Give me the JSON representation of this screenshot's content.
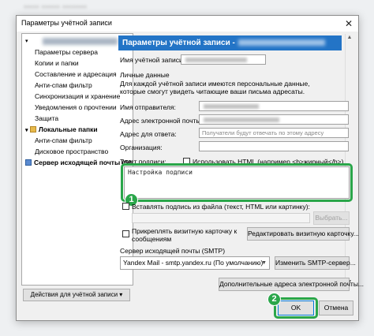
{
  "window": {
    "title": "Параметры учётной записи",
    "close_glyph": "✕"
  },
  "tree": {
    "server_settings": "Параметры сервера",
    "copies_folders": "Копии и папки",
    "composition": "Составление и адресация",
    "spam": "Анти-спам фильтр",
    "sync": "Синхронизация и хранение",
    "receipts": "Уведомления о прочтении",
    "security": "Защита",
    "local_folders": "Локальные папки",
    "local_spam": "Анти-спам фильтр",
    "disk_space": "Дисковое пространство",
    "outgoing_server": "Сервер исходящей почты (SMTP)"
  },
  "account_actions": "Действия для учётной записи ▾",
  "header": "Параметры учётной записи -",
  "account_name_label": "Имя учётной записи:",
  "personal_data_label": "Личные данные",
  "personal_desc": "Для каждой учётной записи имеются персональные данные, которые смогут увидеть читающие ваши письма адресаты.",
  "fields": {
    "sender_name": "Имя отправителя:",
    "email": "Адрес электронной почты:",
    "reply_to": "Адрес для ответа:",
    "reply_to_placeholder": "Получатели будут отвечать по этому адресу",
    "organization": "Организация:"
  },
  "signature": {
    "label": "Текст подписи:",
    "use_html": "Использовать HTML (например <b>жирный</b>)",
    "text": "Настройка подписи",
    "from_file": "Вставлять подпись из файла (текст, HTML или картинку):",
    "choose_btn": "Выбрать..."
  },
  "vcard": {
    "attach": "Прикреплять визитную карточку к сообщениям",
    "edit_btn": "Редактировать визитную карточку..."
  },
  "smtp": {
    "label": "Сервер исходящей почты (SMTP)",
    "selected": "Yandex Mail - smtp.yandex.ru (По умолчанию)",
    "edit_btn": "Изменить SMTP-сервер..."
  },
  "extra_addresses_btn": "Дополнительные адреса электронной почты...",
  "ok": "OK",
  "cancel": "Отмена",
  "badges": {
    "one": "1",
    "two": "2"
  },
  "colors": {
    "accent": "#2374c6",
    "highlight": "#2aa64a"
  }
}
